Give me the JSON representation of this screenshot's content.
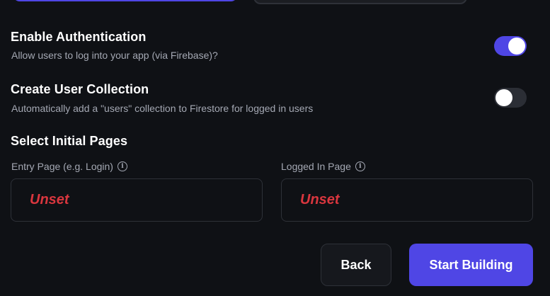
{
  "auth": {
    "title": "Enable Authentication",
    "description": "Allow users to log into your app (via Firebase)?",
    "enabled": true
  },
  "user_collection": {
    "title": "Create User Collection",
    "description": "Automatically add a \"users\" collection to Firestore for logged in users",
    "enabled": false
  },
  "initial_pages": {
    "heading": "Select Initial Pages",
    "entry_page": {
      "label": "Entry Page (e.g. Login)",
      "value": "Unset",
      "icon": "info-icon"
    },
    "logged_in_page": {
      "label": "Logged In Page",
      "value": "Unset",
      "icon": "info-icon"
    }
  },
  "actions": {
    "back_label": "Back",
    "start_label": "Start Building"
  },
  "colors": {
    "accent": "#4f46e5",
    "background": "#0f1115",
    "unset_red": "#d9363e"
  }
}
